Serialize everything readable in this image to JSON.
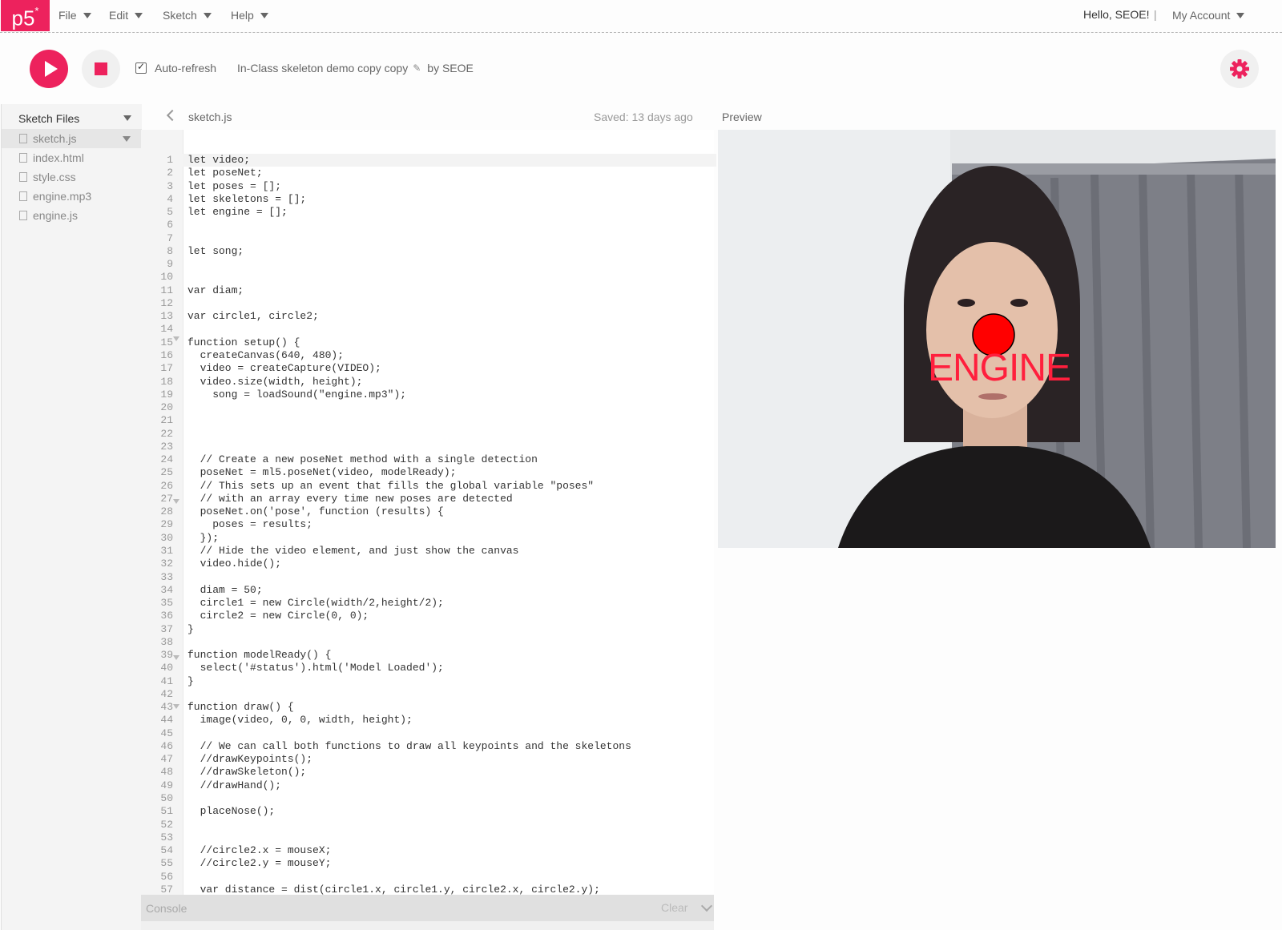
{
  "nav": {
    "logo": "p5",
    "logo_mark": "*",
    "menus": [
      {
        "label": "File"
      },
      {
        "label": "Edit"
      },
      {
        "label": "Sketch"
      },
      {
        "label": "Help"
      }
    ],
    "greeting": "Hello, SEOE!",
    "separator": "|",
    "account": "My Account"
  },
  "toolbar": {
    "autorefresh_label": "Auto-refresh",
    "autorefresh_checked": true,
    "sketch_title": "In-Class skeleton demo copy copy",
    "author": "by SEOE",
    "accent_color": "#ed225d",
    "play_icon": "play-icon",
    "stop_icon": "stop-icon",
    "settings_icon": "gear-icon"
  },
  "sidebar": {
    "title": "Sketch Files",
    "files": [
      {
        "name": "sketch.js",
        "active": true
      },
      {
        "name": "index.html"
      },
      {
        "name": "style.css"
      },
      {
        "name": "engine.mp3"
      },
      {
        "name": "engine.js"
      }
    ]
  },
  "editor": {
    "filename": "sketch.js",
    "saved": "Saved: 13 days ago",
    "line_numbers": [
      "1",
      "2",
      "3",
      "4",
      "5",
      "6",
      "7",
      "8",
      "9",
      "10",
      "11",
      "12",
      "13",
      "14",
      "15",
      "16",
      "17",
      "18",
      "19",
      "20",
      "21",
      "22",
      "23",
      "24",
      "25",
      "26",
      "27",
      "28",
      "29",
      "30",
      "31",
      "32",
      "33",
      "34",
      "35",
      "36",
      "37",
      "38",
      "39",
      "40",
      "41",
      "42",
      "43",
      "44",
      "45",
      "46",
      "47",
      "48",
      "49",
      "50",
      "51",
      "52",
      "53",
      "54",
      "55",
      "56",
      "57"
    ],
    "code": [
      "let video;",
      "let poseNet;",
      "let poses = [];",
      "let skeletons = [];",
      "let engine = [];",
      "",
      "",
      "let song;",
      "",
      "",
      "var diam;",
      "",
      "var circle1, circle2;",
      "",
      "function setup() {",
      "  createCanvas(640, 480);",
      "  video = createCapture(VIDEO);",
      "  video.size(width, height);",
      "    song = loadSound(\"engine.mp3\");",
      "",
      "",
      "",
      "",
      "  // Create a new poseNet method with a single detection",
      "  poseNet = ml5.poseNet(video, modelReady);",
      "  // This sets up an event that fills the global variable \"poses\"",
      "  // with an array every time new poses are detected",
      "  poseNet.on('pose', function (results) {",
      "    poses = results;",
      "  });",
      "  // Hide the video element, and just show the canvas",
      "  video.hide();",
      "",
      "  diam = 50;",
      "  circle1 = new Circle(width/2,height/2);",
      "  circle2 = new Circle(0, 0);",
      "}",
      "",
      "function modelReady() {",
      "  select('#status').html('Model Loaded');",
      "}",
      "",
      "function draw() {",
      "  image(video, 0, 0, width, height);",
      "",
      "  // We can call both functions to draw all keypoints and the skeletons",
      "  //drawKeypoints();",
      "  //drawSkeleton();",
      "  //drawHand();",
      "",
      "  placeNose();",
      "",
      "",
      "  //circle2.x = mouseX;",
      "  //circle2.y = mouseY;",
      "",
      "  var distance = dist(circle1.x, circle1.y, circle2.x, circle2.y);"
    ]
  },
  "preview": {
    "label": "Preview",
    "overlay_text": "ENGINE",
    "overlay_color": "#ff1f3d",
    "nose_circle_color": "#ff0000"
  },
  "console": {
    "label": "Console",
    "clear": "Clear"
  }
}
